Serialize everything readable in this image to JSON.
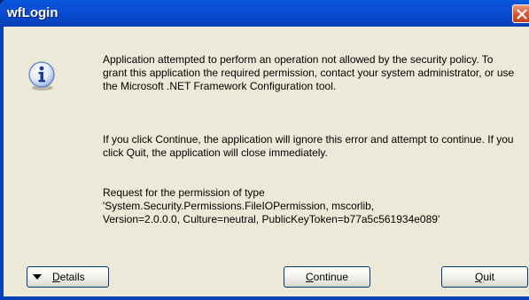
{
  "window": {
    "title": "wfLogin"
  },
  "message": {
    "paragraph1": "Application attempted to perform an operation not allowed by the security policy. To grant this application the required permission, contact your system administrator, or use the Microsoft .NET Framework Configuration tool.",
    "paragraph2": "If you click Continue, the application will ignore this error and attempt to continue. If you click Quit, the application will close immediately.",
    "paragraph3_line1": "Request for the permission of type",
    "paragraph3_line2": "'System.Security.Permissions.FileIOPermission, mscorlib,",
    "paragraph3_line3": "Version=2.0.0.0, Culture=neutral, PublicKeyToken=b77a5c561934e089'"
  },
  "buttons": {
    "details_mnemonic": "D",
    "details_rest": "etails",
    "continue_mnemonic": "C",
    "continue_rest": "ontinue",
    "quit_mnemonic": "Q",
    "quit_rest": "uit"
  },
  "icons": {
    "info": "information-icon",
    "close": "close-icon",
    "details_arrow": "triangle-down-icon"
  },
  "colors": {
    "titlebar": "#0a4ed3",
    "dialog_bg": "#ece9d8",
    "close_btn": "#d9582f"
  }
}
